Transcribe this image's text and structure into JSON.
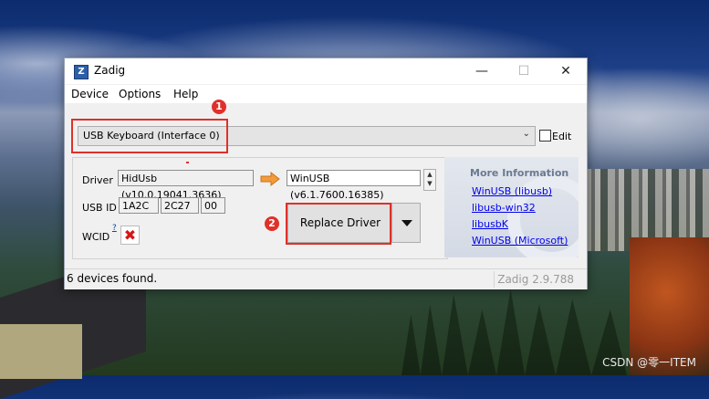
{
  "window": {
    "title": "Zadig",
    "controls": {
      "minimize": "—",
      "maximize": "☐",
      "close": "✕"
    }
  },
  "menu": [
    "Device",
    "Options",
    "Help"
  ],
  "device": {
    "selected": "USB Keyboard (Interface 0)",
    "edit_label": "Edit",
    "edit_checked": false
  },
  "driver": {
    "driver_label": "Driver",
    "current_driver": "HidUsb (v10.0.19041.3636)",
    "target_driver": "WinUSB (v6.1.7600.16385)",
    "usbid_label": "USB ID",
    "usb_id": [
      "1A2C",
      "2C27",
      "00"
    ],
    "wcid_label": "WCID",
    "wcid_help": "?",
    "wcid_status": "✖"
  },
  "actions": {
    "replace_driver": "Replace Driver"
  },
  "more_info": {
    "title": "More Information",
    "links": [
      "WinUSB (libusb)",
      "libusb-win32",
      "libusbK",
      "WinUSB (Microsoft)"
    ]
  },
  "status": {
    "message": "6 devices found.",
    "version": "Zadig 2.9.788"
  },
  "annotations": {
    "badge1": "1",
    "badge2": "2",
    "color": "#e0302a"
  },
  "watermark": "CSDN @零一ITEM",
  "colors": {
    "accent_arrow": "#f39a3a",
    "link": "#0000ee",
    "window_bg": "#f0f0f0"
  }
}
